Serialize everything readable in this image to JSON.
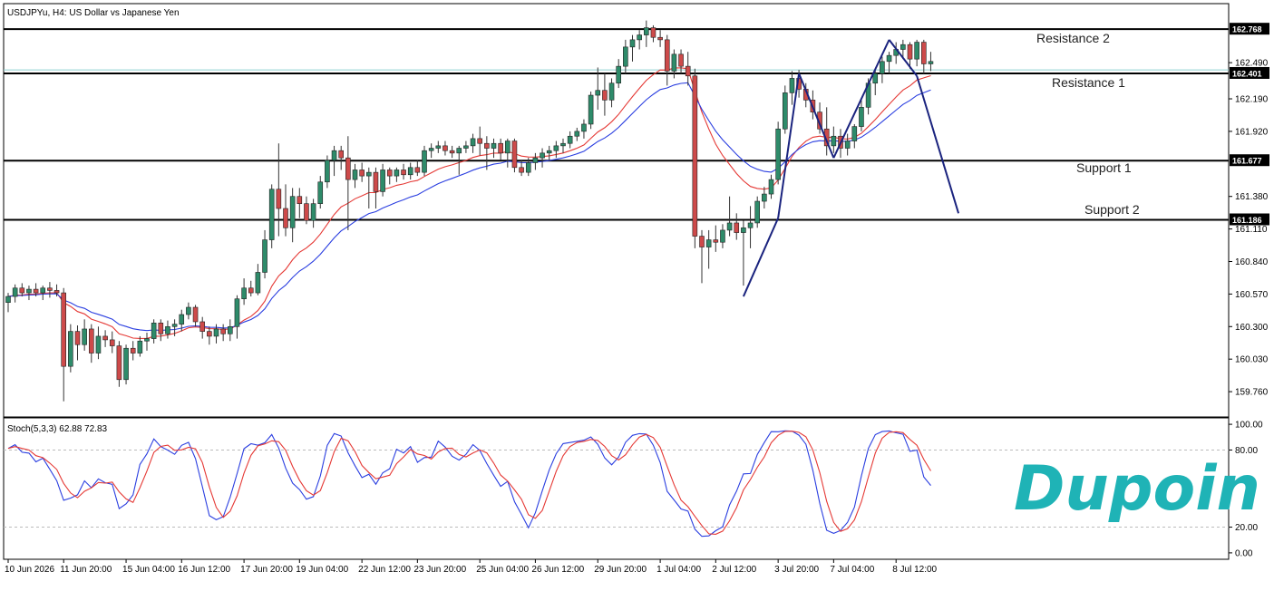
{
  "chart_data": {
    "type": "candlestick",
    "title": "USDJPYu, H4:  US Dollar vs Japanese Yen",
    "ylim": [
      159.55,
      162.98
    ],
    "price_ticks": [
      "162.768",
      "162.490",
      "162.401",
      "162.190",
      "161.920",
      "161.677",
      "161.380",
      "161.186",
      "161.110",
      "160.840",
      "160.570",
      "160.300",
      "160.030",
      "159.760"
    ],
    "time_labels": [
      {
        "i": 0,
        "label": "10 Jun 2026"
      },
      {
        "i": 8,
        "label": "11 Jun 20:00"
      },
      {
        "i": 17,
        "label": "15 Jun 04:00"
      },
      {
        "i": 25,
        "label": "16 Jun 12:00"
      },
      {
        "i": 34,
        "label": "17 Jun 20:00"
      },
      {
        "i": 42,
        "label": "19 Jun 04:00"
      },
      {
        "i": 51,
        "label": "22 Jun 12:00"
      },
      {
        "i": 59,
        "label": "23 Jun 20:00"
      },
      {
        "i": 68,
        "label": "25 Jun 04:00"
      },
      {
        "i": 76,
        "label": "26 Jun 12:00"
      },
      {
        "i": 85,
        "label": "29 Jun 20:00"
      },
      {
        "i": 94,
        "label": "1 Jul 04:00"
      },
      {
        "i": 102,
        "label": "2 Jul 12:00"
      },
      {
        "i": 111,
        "label": "3 Jul 20:00"
      },
      {
        "i": 119,
        "label": "7 Jul 04:00"
      },
      {
        "i": 128,
        "label": "8 Jul 12:00"
      }
    ],
    "levels": [
      {
        "name": "Resistance 2",
        "price": 162.768,
        "label": "162.768"
      },
      {
        "name": "Resistance 1",
        "price": 162.401,
        "label": "162.401"
      },
      {
        "name": "Support 1",
        "price": 161.677,
        "label": "161.677"
      },
      {
        "name": "Support 2",
        "price": 161.186,
        "label": "161.186"
      }
    ],
    "bid_line": 162.43,
    "candles": [
      {
        "o": 160.5,
        "h": 160.58,
        "l": 160.42,
        "c": 160.55
      },
      {
        "o": 160.55,
        "h": 160.65,
        "l": 160.5,
        "c": 160.62
      },
      {
        "o": 160.62,
        "h": 160.66,
        "l": 160.55,
        "c": 160.58
      },
      {
        "o": 160.58,
        "h": 160.64,
        "l": 160.52,
        "c": 160.61
      },
      {
        "o": 160.61,
        "h": 160.66,
        "l": 160.55,
        "c": 160.58
      },
      {
        "o": 160.58,
        "h": 160.64,
        "l": 160.52,
        "c": 160.62
      },
      {
        "o": 160.62,
        "h": 160.67,
        "l": 160.54,
        "c": 160.6
      },
      {
        "o": 160.6,
        "h": 160.65,
        "l": 160.55,
        "c": 160.58
      },
      {
        "o": 160.58,
        "h": 160.62,
        "l": 159.68,
        "c": 159.97
      },
      {
        "o": 159.97,
        "h": 160.32,
        "l": 159.92,
        "c": 160.26
      },
      {
        "o": 160.26,
        "h": 160.31,
        "l": 160.02,
        "c": 160.15
      },
      {
        "o": 160.15,
        "h": 160.36,
        "l": 160.1,
        "c": 160.28
      },
      {
        "o": 160.28,
        "h": 160.32,
        "l": 160.0,
        "c": 160.08
      },
      {
        "o": 160.08,
        "h": 160.3,
        "l": 160.03,
        "c": 160.22
      },
      {
        "o": 160.22,
        "h": 160.27,
        "l": 160.13,
        "c": 160.19
      },
      {
        "o": 160.19,
        "h": 160.26,
        "l": 160.08,
        "c": 160.14
      },
      {
        "o": 160.14,
        "h": 160.18,
        "l": 159.8,
        "c": 159.86
      },
      {
        "o": 159.86,
        "h": 160.15,
        "l": 159.82,
        "c": 160.12
      },
      {
        "o": 160.12,
        "h": 160.18,
        "l": 160.02,
        "c": 160.08
      },
      {
        "o": 160.08,
        "h": 160.22,
        "l": 160.05,
        "c": 160.18
      },
      {
        "o": 160.18,
        "h": 160.25,
        "l": 160.1,
        "c": 160.2
      },
      {
        "o": 160.2,
        "h": 160.36,
        "l": 160.16,
        "c": 160.33
      },
      {
        "o": 160.33,
        "h": 160.36,
        "l": 160.18,
        "c": 160.24
      },
      {
        "o": 160.24,
        "h": 160.35,
        "l": 160.2,
        "c": 160.3
      },
      {
        "o": 160.3,
        "h": 160.36,
        "l": 160.22,
        "c": 160.32
      },
      {
        "o": 160.32,
        "h": 160.44,
        "l": 160.26,
        "c": 160.4
      },
      {
        "o": 160.4,
        "h": 160.5,
        "l": 160.36,
        "c": 160.46
      },
      {
        "o": 160.46,
        "h": 160.48,
        "l": 160.3,
        "c": 160.34
      },
      {
        "o": 160.34,
        "h": 160.38,
        "l": 160.2,
        "c": 160.26
      },
      {
        "o": 160.26,
        "h": 160.3,
        "l": 160.15,
        "c": 160.22
      },
      {
        "o": 160.22,
        "h": 160.32,
        "l": 160.16,
        "c": 160.28
      },
      {
        "o": 160.28,
        "h": 160.32,
        "l": 160.18,
        "c": 160.24
      },
      {
        "o": 160.24,
        "h": 160.36,
        "l": 160.18,
        "c": 160.3
      },
      {
        "o": 160.3,
        "h": 160.56,
        "l": 160.2,
        "c": 160.53
      },
      {
        "o": 160.53,
        "h": 160.7,
        "l": 160.48,
        "c": 160.62
      },
      {
        "o": 160.62,
        "h": 160.68,
        "l": 160.55,
        "c": 160.58
      },
      {
        "o": 160.58,
        "h": 160.82,
        "l": 160.56,
        "c": 160.75
      },
      {
        "o": 160.75,
        "h": 161.1,
        "l": 160.7,
        "c": 161.02
      },
      {
        "o": 161.02,
        "h": 161.48,
        "l": 160.95,
        "c": 161.44
      },
      {
        "o": 161.44,
        "h": 161.82,
        "l": 161.05,
        "c": 161.28
      },
      {
        "o": 161.28,
        "h": 161.48,
        "l": 161.05,
        "c": 161.12
      },
      {
        "o": 161.12,
        "h": 161.45,
        "l": 161.0,
        "c": 161.38
      },
      {
        "o": 161.38,
        "h": 161.45,
        "l": 161.2,
        "c": 161.32
      },
      {
        "o": 161.32,
        "h": 161.38,
        "l": 161.15,
        "c": 161.18
      },
      {
        "o": 161.18,
        "h": 161.36,
        "l": 161.12,
        "c": 161.32
      },
      {
        "o": 161.32,
        "h": 161.55,
        "l": 161.28,
        "c": 161.5
      },
      {
        "o": 161.5,
        "h": 161.72,
        "l": 161.45,
        "c": 161.68
      },
      {
        "o": 161.68,
        "h": 161.8,
        "l": 161.55,
        "c": 161.76
      },
      {
        "o": 161.76,
        "h": 161.8,
        "l": 161.6,
        "c": 161.7
      },
      {
        "o": 161.7,
        "h": 161.88,
        "l": 161.1,
        "c": 161.52
      },
      {
        "o": 161.52,
        "h": 161.65,
        "l": 161.45,
        "c": 161.6
      },
      {
        "o": 161.6,
        "h": 161.66,
        "l": 161.5,
        "c": 161.55
      },
      {
        "o": 161.55,
        "h": 161.62,
        "l": 161.28,
        "c": 161.58
      },
      {
        "o": 161.58,
        "h": 161.62,
        "l": 161.28,
        "c": 161.42
      },
      {
        "o": 161.42,
        "h": 161.65,
        "l": 161.38,
        "c": 161.6
      },
      {
        "o": 161.6,
        "h": 161.62,
        "l": 161.48,
        "c": 161.55
      },
      {
        "o": 161.55,
        "h": 161.62,
        "l": 161.5,
        "c": 161.6
      },
      {
        "o": 161.6,
        "h": 161.65,
        "l": 161.52,
        "c": 161.56
      },
      {
        "o": 161.56,
        "h": 161.66,
        "l": 161.52,
        "c": 161.62
      },
      {
        "o": 161.62,
        "h": 161.68,
        "l": 161.55,
        "c": 161.58
      },
      {
        "o": 161.58,
        "h": 161.8,
        "l": 161.55,
        "c": 161.76
      },
      {
        "o": 161.76,
        "h": 161.82,
        "l": 161.7,
        "c": 161.78
      },
      {
        "o": 161.78,
        "h": 161.84,
        "l": 161.74,
        "c": 161.8
      },
      {
        "o": 161.8,
        "h": 161.84,
        "l": 161.72,
        "c": 161.76
      },
      {
        "o": 161.76,
        "h": 161.8,
        "l": 161.7,
        "c": 161.74
      },
      {
        "o": 161.74,
        "h": 161.8,
        "l": 161.56,
        "c": 161.78
      },
      {
        "o": 161.78,
        "h": 161.84,
        "l": 161.74,
        "c": 161.8
      },
      {
        "o": 161.8,
        "h": 161.9,
        "l": 161.74,
        "c": 161.86
      },
      {
        "o": 161.86,
        "h": 161.96,
        "l": 161.72,
        "c": 161.82
      },
      {
        "o": 161.82,
        "h": 161.88,
        "l": 161.6,
        "c": 161.78
      },
      {
        "o": 161.78,
        "h": 161.86,
        "l": 161.7,
        "c": 161.82
      },
      {
        "o": 161.82,
        "h": 161.86,
        "l": 161.68,
        "c": 161.74
      },
      {
        "o": 161.74,
        "h": 161.86,
        "l": 161.62,
        "c": 161.84
      },
      {
        "o": 161.84,
        "h": 161.86,
        "l": 161.58,
        "c": 161.62
      },
      {
        "o": 161.62,
        "h": 161.68,
        "l": 161.55,
        "c": 161.58
      },
      {
        "o": 161.58,
        "h": 161.7,
        "l": 161.55,
        "c": 161.66
      },
      {
        "o": 161.66,
        "h": 161.74,
        "l": 161.6,
        "c": 161.7
      },
      {
        "o": 161.7,
        "h": 161.78,
        "l": 161.62,
        "c": 161.74
      },
      {
        "o": 161.74,
        "h": 161.8,
        "l": 161.68,
        "c": 161.76
      },
      {
        "o": 161.76,
        "h": 161.84,
        "l": 161.7,
        "c": 161.8
      },
      {
        "o": 161.8,
        "h": 161.86,
        "l": 161.74,
        "c": 161.82
      },
      {
        "o": 161.82,
        "h": 161.92,
        "l": 161.78,
        "c": 161.88
      },
      {
        "o": 161.88,
        "h": 161.95,
        "l": 161.84,
        "c": 161.92
      },
      {
        "o": 161.92,
        "h": 162.02,
        "l": 161.86,
        "c": 161.98
      },
      {
        "o": 161.98,
        "h": 162.25,
        "l": 161.94,
        "c": 162.22
      },
      {
        "o": 162.22,
        "h": 162.45,
        "l": 162.1,
        "c": 162.26
      },
      {
        "o": 162.26,
        "h": 162.4,
        "l": 162.05,
        "c": 162.18
      },
      {
        "o": 162.18,
        "h": 162.36,
        "l": 162.12,
        "c": 162.32
      },
      {
        "o": 162.32,
        "h": 162.52,
        "l": 162.28,
        "c": 162.46
      },
      {
        "o": 162.46,
        "h": 162.68,
        "l": 162.4,
        "c": 162.62
      },
      {
        "o": 162.62,
        "h": 162.72,
        "l": 162.5,
        "c": 162.68
      },
      {
        "o": 162.68,
        "h": 162.76,
        "l": 162.6,
        "c": 162.72
      },
      {
        "o": 162.72,
        "h": 162.84,
        "l": 162.62,
        "c": 162.78
      },
      {
        "o": 162.78,
        "h": 162.8,
        "l": 162.66,
        "c": 162.7
      },
      {
        "o": 162.7,
        "h": 162.76,
        "l": 162.62,
        "c": 162.68
      },
      {
        "o": 162.68,
        "h": 162.72,
        "l": 162.3,
        "c": 162.42
      },
      {
        "o": 162.42,
        "h": 162.6,
        "l": 162.36,
        "c": 162.56
      },
      {
        "o": 162.56,
        "h": 162.6,
        "l": 162.4,
        "c": 162.46
      },
      {
        "o": 162.46,
        "h": 162.58,
        "l": 162.3,
        "c": 162.38
      },
      {
        "o": 162.38,
        "h": 162.44,
        "l": 160.95,
        "c": 161.05
      },
      {
        "o": 161.05,
        "h": 161.1,
        "l": 160.66,
        "c": 160.96
      },
      {
        "o": 160.96,
        "h": 161.1,
        "l": 160.78,
        "c": 161.02
      },
      {
        "o": 161.02,
        "h": 161.14,
        "l": 160.92,
        "c": 161.0
      },
      {
        "o": 161.0,
        "h": 161.15,
        "l": 160.95,
        "c": 161.1
      },
      {
        "o": 161.1,
        "h": 161.38,
        "l": 161.05,
        "c": 161.16
      },
      {
        "o": 161.16,
        "h": 161.24,
        "l": 161.02,
        "c": 161.08
      },
      {
        "o": 161.08,
        "h": 161.18,
        "l": 160.64,
        "c": 161.12
      },
      {
        "o": 161.12,
        "h": 161.3,
        "l": 160.95,
        "c": 161.16
      },
      {
        "o": 161.16,
        "h": 161.38,
        "l": 161.12,
        "c": 161.34
      },
      {
        "o": 161.34,
        "h": 161.46,
        "l": 161.28,
        "c": 161.4
      },
      {
        "o": 161.4,
        "h": 161.56,
        "l": 161.36,
        "c": 161.52
      },
      {
        "o": 161.52,
        "h": 162.0,
        "l": 161.48,
        "c": 161.94
      },
      {
        "o": 161.94,
        "h": 162.3,
        "l": 161.9,
        "c": 162.24
      },
      {
        "o": 162.24,
        "h": 162.42,
        "l": 162.14,
        "c": 162.36
      },
      {
        "o": 162.36,
        "h": 162.43,
        "l": 162.2,
        "c": 162.27
      },
      {
        "o": 162.27,
        "h": 162.32,
        "l": 162.12,
        "c": 162.18
      },
      {
        "o": 162.18,
        "h": 162.26,
        "l": 162.02,
        "c": 162.08
      },
      {
        "o": 162.08,
        "h": 162.16,
        "l": 161.9,
        "c": 161.94
      },
      {
        "o": 161.94,
        "h": 162.12,
        "l": 161.72,
        "c": 161.8
      },
      {
        "o": 161.8,
        "h": 161.96,
        "l": 161.74,
        "c": 161.88
      },
      {
        "o": 161.88,
        "h": 161.94,
        "l": 161.7,
        "c": 161.78
      },
      {
        "o": 161.78,
        "h": 161.9,
        "l": 161.72,
        "c": 161.84
      },
      {
        "o": 161.84,
        "h": 161.98,
        "l": 161.78,
        "c": 161.96
      },
      {
        "o": 161.96,
        "h": 162.18,
        "l": 161.92,
        "c": 162.12
      },
      {
        "o": 162.12,
        "h": 162.36,
        "l": 162.06,
        "c": 162.32
      },
      {
        "o": 162.32,
        "h": 162.44,
        "l": 162.22,
        "c": 162.4
      },
      {
        "o": 162.4,
        "h": 162.54,
        "l": 162.32,
        "c": 162.5
      },
      {
        "o": 162.5,
        "h": 162.58,
        "l": 162.4,
        "c": 162.55
      },
      {
        "o": 162.55,
        "h": 162.66,
        "l": 162.48,
        "c": 162.6
      },
      {
        "o": 162.6,
        "h": 162.68,
        "l": 162.52,
        "c": 162.64
      },
      {
        "o": 162.64,
        "h": 162.66,
        "l": 162.44,
        "c": 162.52
      },
      {
        "o": 162.52,
        "h": 162.68,
        "l": 162.46,
        "c": 162.66
      },
      {
        "o": 162.66,
        "h": 162.68,
        "l": 162.4,
        "c": 162.48
      },
      {
        "o": 162.48,
        "h": 162.58,
        "l": 162.42,
        "c": 162.5
      }
    ],
    "ma_fast_color": "#e53935",
    "ma_slow_color": "#2a3ee0",
    "bull_color": "#2e8b6a",
    "bear_color": "#cd4a4a",
    "drawing_color": "#1a237e",
    "pattern_lines": [
      {
        "from": {
          "i": 114,
          "p": 162.4
        },
        "to": {
          "i": 119,
          "p": 161.7
        }
      },
      {
        "from": {
          "i": 119,
          "p": 161.7
        },
        "to": {
          "i": 127,
          "p": 162.68
        }
      },
      {
        "from": {
          "i": 127,
          "p": 162.68
        },
        "to": {
          "i": 131,
          "p": 162.38
        }
      },
      {
        "from": {
          "i": 131,
          "p": 162.38
        },
        "to": {
          "i": 137,
          "p": 161.24
        }
      },
      {
        "from": {
          "i": 106,
          "p": 160.55
        },
        "to": {
          "i": 111,
          "p": 161.2
        }
      },
      {
        "from": {
          "i": 111,
          "p": 161.2
        },
        "to": {
          "i": 114,
          "p": 162.4
        }
      }
    ],
    "stoch": {
      "label": "Stoch(5,3,3) 62.88 72.83",
      "ylim": [
        -5,
        105
      ],
      "levels": [
        20,
        80
      ],
      "ticks": [
        "100.00",
        "80.00",
        "20.00",
        "0.00"
      ],
      "k_color": "#2a3ee0",
      "d_color": "#e53935"
    }
  },
  "brand": {
    "logo_text": "Dupoin",
    "logo_color": "#1fb3b6"
  }
}
